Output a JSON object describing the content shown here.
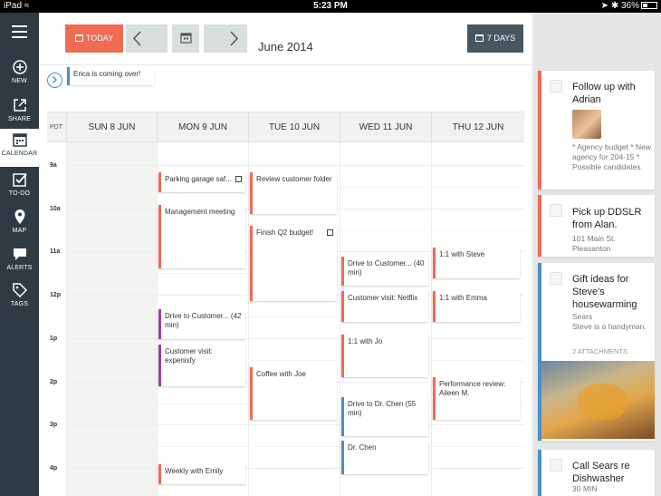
{
  "status_bar": {
    "device": "iPad",
    "time": "5:23 PM",
    "battery": "36%",
    "battery_level": 0.36
  },
  "sidebar": {
    "items": [
      {
        "label": "NEW",
        "icon": "plus-circle-icon"
      },
      {
        "label": "SHARE",
        "icon": "share-icon"
      },
      {
        "label": "CALENDAR",
        "icon": "calendar-icon",
        "active": true
      },
      {
        "label": "TO-DO",
        "icon": "checkbox-icon"
      },
      {
        "label": "MAP",
        "icon": "map-pin-icon"
      },
      {
        "label": "ALERTS",
        "icon": "speech-bubble-icon"
      },
      {
        "label": "TAGS",
        "icon": "tag-icon"
      }
    ]
  },
  "toolbar": {
    "today_label": "TODAY",
    "title": "June 2014",
    "days_label": "7 DAYS"
  },
  "all_day": {
    "event": "Erica is coming over!"
  },
  "calendar": {
    "timezone": "PDT",
    "days": [
      "SUN 8 JUN",
      "MON 9 JUN",
      "TUE 10 JUN",
      "WED 11 JUN",
      "THU 12 JUN"
    ],
    "hours": [
      "9a",
      "10a",
      "11a",
      "12p",
      "1p",
      "2p",
      "3p",
      "4p"
    ],
    "events": [
      {
        "title": "Parking garage saf...",
        "day": "MON 9 JUN",
        "start": "9:15",
        "end": "9:45",
        "checkbox": true
      },
      {
        "title": "Management meeting",
        "day": "MON 9 JUN",
        "start": "9:45",
        "end": "11:15"
      },
      {
        "title": "Drive to Customer... (42 min)",
        "day": "MON 9 JUN",
        "start": "12:18",
        "end": "1:00"
      },
      {
        "title": "Customer visit: expenisfy",
        "day": "MON 9 JUN",
        "start": "1:00",
        "end": "2:00"
      },
      {
        "title": "Weekly with Emily",
        "day": "MON 9 JUN",
        "start": "3:50",
        "end": "4:20"
      },
      {
        "title": "Review customer folder",
        "day": "TUE 10 JUN",
        "start": "9:15",
        "end": "10:15"
      },
      {
        "title": "Finish Q2 budget!",
        "day": "TUE 10 JUN",
        "start": "10:30",
        "end": "12:15",
        "checkbox": true
      },
      {
        "title": "Coffee with Joe",
        "day": "TUE 10 JUN",
        "start": "1:40",
        "end": "2:55"
      },
      {
        "title": "Drive to Customer... (40 min)",
        "day": "WED 11 JUN",
        "start": "11:05",
        "end": "11:45"
      },
      {
        "title": "Customer visit: Netflix",
        "day": "WED 11 JUN",
        "start": "11:50",
        "end": "12:40"
      },
      {
        "title": "1:1 with Jo",
        "day": "WED 11 JUN",
        "start": "12:55",
        "end": "1:55"
      },
      {
        "title": "Drive to Dr. Chen (55 min)",
        "day": "WED 11 JUN",
        "start": "2:20",
        "end": "3:15"
      },
      {
        "title": "Dr. Chen",
        "day": "WED 11 JUN",
        "start": "3:20",
        "end": "4:05"
      },
      {
        "title": "1:1 with Steve",
        "day": "THU 12 JUN",
        "start": "10:55",
        "end": "11:40"
      },
      {
        "title": "1:1 with Emma",
        "day": "THU 12 JUN",
        "start": "11:55",
        "end": "12:40"
      },
      {
        "title": "Performance review: Aileen M.",
        "day": "THU 12 JUN",
        "start": "2:00",
        "end": "3:00"
      }
    ]
  },
  "todos": [
    {
      "title": "Follow up with Adrian",
      "note": "* Agency budget  * New agency for 204-15 * Possible candidates"
    },
    {
      "title": "Pick up DDSLR from Alan.",
      "note": "101 Main St. Pleasanton"
    },
    {
      "title": "Gift ideas for Steve's housewarming",
      "note": "Sears\nSteve is a handyman.",
      "attachments": "2 ATTACHMENTS"
    },
    {
      "title": "Call Sears re Dishwasher",
      "note": "30 MIN"
    }
  ]
}
